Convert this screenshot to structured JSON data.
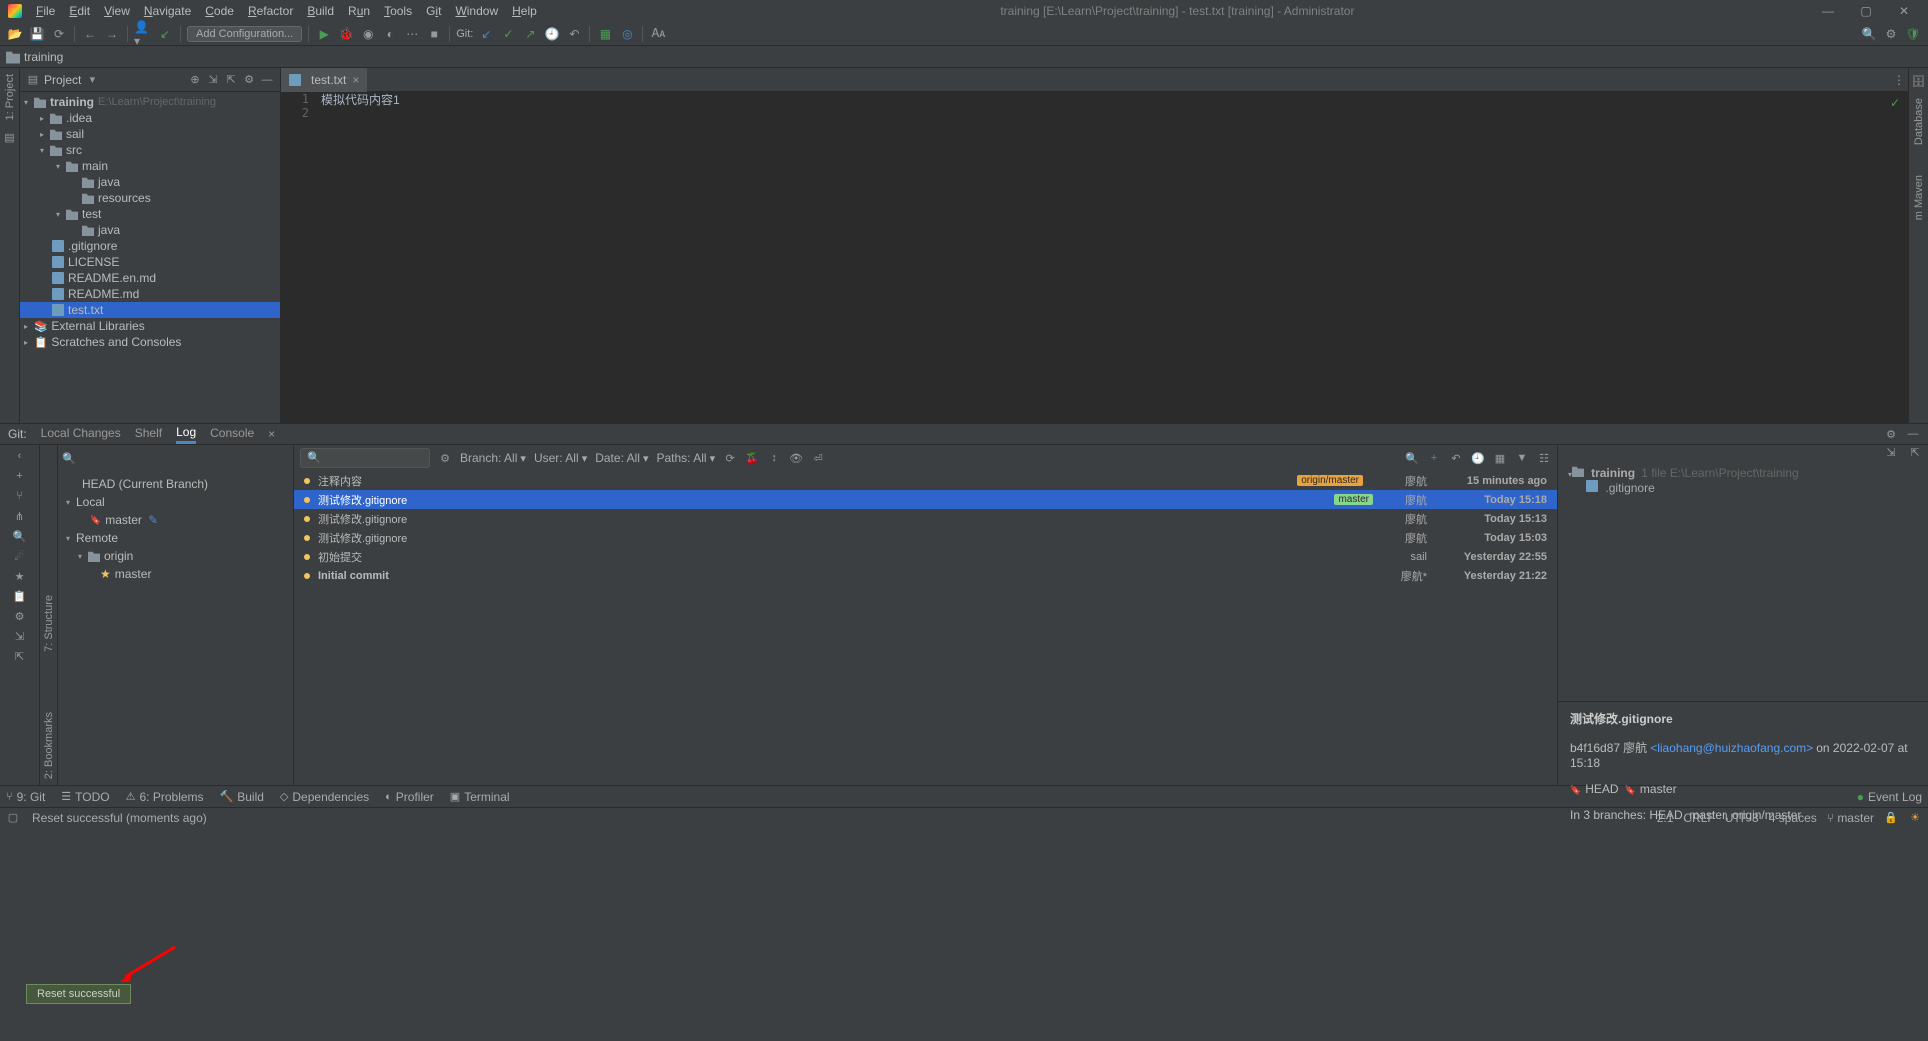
{
  "window_title": "training [E:\\Learn\\Project\\training] - test.txt [training] - Administrator",
  "menu": [
    "File",
    "Edit",
    "View",
    "Navigate",
    "Code",
    "Refactor",
    "Build",
    "Run",
    "Tools",
    "Git",
    "Window",
    "Help"
  ],
  "add_config": "Add Configuration...",
  "git_label": "Git:",
  "breadcrumb": "training",
  "panel_title": "Project",
  "side_left": {
    "project": "1: Project"
  },
  "side_right": {
    "database": "Database",
    "maven": "m Maven"
  },
  "tree": {
    "root": "training",
    "root_path": "E:\\Learn\\Project\\training",
    "idea": ".idea",
    "sail": "sail",
    "src": "src",
    "main": "main",
    "java": "java",
    "resources": "resources",
    "test": "test",
    "java2": "java",
    "gitignore": ".gitignore",
    "license": "LICENSE",
    "readme_en": "README.en.md",
    "readme": "README.md",
    "testtxt": "test.txt",
    "ext": "External Libraries",
    "scratch": "Scratches and Consoles"
  },
  "editor_tab": "test.txt",
  "editor_lines": {
    "l1": "模拟代码内容1"
  },
  "git_panel": {
    "label": "Git:",
    "tabs": {
      "local": "Local Changes",
      "shelf": "Shelf",
      "log": "Log",
      "console": "Console"
    },
    "head": "HEAD (Current Branch)",
    "local": "Local",
    "local_master": "master",
    "remote": "Remote",
    "origin": "origin",
    "origin_master": "master",
    "filters": {
      "branch": "Branch: All",
      "user": "User: All",
      "date": "Date: All",
      "paths": "Paths: All"
    },
    "commits": [
      {
        "msg": "注释内容",
        "author": "廖航",
        "date": "15 minutes ago",
        "badge": "origin/master"
      },
      {
        "msg": "测试修改.gitignore",
        "author": "廖航",
        "date": "Today 15:18",
        "badge": "master"
      },
      {
        "msg": "测试修改.gitignore",
        "author": "廖航",
        "date": "Today 15:13"
      },
      {
        "msg": "测试修改.gitignore",
        "author": "廖航",
        "date": "Today 15:03"
      },
      {
        "msg": "初始提交",
        "author": "sail",
        "date": "Yesterday 22:55"
      },
      {
        "msg": "Initial commit",
        "author": "廖航*",
        "date": "Yesterday 21:22"
      }
    ],
    "details_root": "training",
    "details_root_info": "1 file  E:\\Learn\\Project\\training",
    "details_file": ".gitignore",
    "commit_title": "测试修改.gitignore",
    "commit_hash": "b4f16d87",
    "commit_author": "廖航",
    "commit_email": "<liaohang@huizhaofang.com>",
    "commit_date": "on 2022-02-07 at 15:18",
    "commit_head": "HEAD",
    "commit_master": "master",
    "commit_branches": "In 3 branches: HEAD, master, origin/master"
  },
  "bottom": {
    "git": "9: Git",
    "todo": "TODO",
    "problems": "6: Problems",
    "build": "Build",
    "deps": "Dependencies",
    "profiler": "Profiler",
    "terminal": "Terminal",
    "eventlog": "Event Log"
  },
  "status": {
    "msg": "Reset successful (moments ago)",
    "pos": "2:1",
    "le": "CRLF",
    "enc": "UTF-8",
    "indent": "4 spaces",
    "branch": "master"
  },
  "tooltip": "Reset successful"
}
